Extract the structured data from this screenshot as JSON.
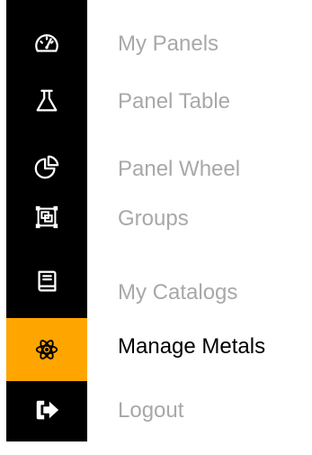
{
  "menu": {
    "items": [
      {
        "label": "My Panels",
        "icon": "speedometer-icon"
      },
      {
        "label": "Panel Table",
        "icon": "flask-icon"
      },
      {
        "label": "Panel Wheel",
        "icon": "pie-chart-icon"
      },
      {
        "label": "Groups",
        "icon": "group-objects-icon"
      },
      {
        "label": "My Catalogs",
        "icon": "catalog-book-icon"
      },
      {
        "label": "Manage Metals",
        "icon": "atom-icon",
        "active": true
      },
      {
        "label": "Logout",
        "icon": "logout-arrow-icon"
      }
    ]
  },
  "colors": {
    "rail": "#000000",
    "active_background": "#ffa500",
    "inactive_text": "#a8a8a8",
    "active_text": "#000000"
  }
}
